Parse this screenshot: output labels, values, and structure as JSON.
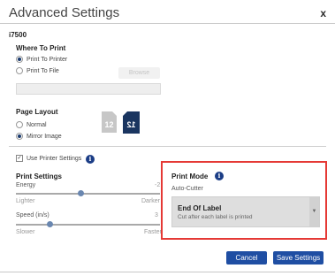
{
  "dialog": {
    "title": "Advanced Settings",
    "close_label": "x",
    "model": "i7500"
  },
  "where_to_print": {
    "heading": "Where To Print",
    "options": [
      {
        "label": "Print To Printer",
        "checked": true
      },
      {
        "label": "Print To File",
        "checked": false
      }
    ],
    "browse_label": "Browse",
    "file_path_value": ""
  },
  "page_layout": {
    "heading": "Page Layout",
    "options": [
      {
        "label": "Normal",
        "checked": false
      },
      {
        "label": "Mirror Image",
        "checked": true
      }
    ],
    "normal_icon_text": "12",
    "mirror_icon_text": "12"
  },
  "printer_settings": {
    "use_label": "Use Printer Settings",
    "use_checked": true,
    "heading": "Print Settings",
    "energy": {
      "label": "Energy",
      "value": "-2",
      "min_label": "Lighter",
      "max_label": "Darker",
      "slider_fraction": 0.5
    },
    "speed": {
      "label": "Speed (in/s)",
      "value": "3",
      "min_label": "Slower",
      "max_label": "Faster",
      "slider_fraction": 0.25
    }
  },
  "print_mode": {
    "heading": "Print Mode",
    "cutter_label": "Auto-Cutter",
    "selected_title": "End Of Label",
    "selected_desc": "Cut after each label is printed",
    "highlight_color": "#e53935"
  },
  "footer": {
    "cancel_label": "Cancel",
    "save_label": "Save Settings"
  },
  "colors": {
    "accent": "#1f4ea3",
    "mirror_icon": "#1a3560"
  }
}
